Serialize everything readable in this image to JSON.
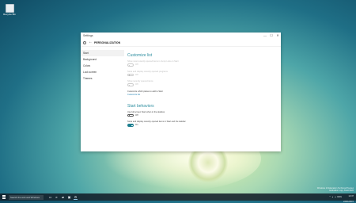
{
  "desktop": {
    "icon_label": "Recycle Bin",
    "watermark": {
      "line1": "Windows 10 Education Technical Preview",
      "line2": "Evaluation copy. Build 9926"
    }
  },
  "window": {
    "title": "Settings",
    "minimize": "—",
    "maximize": "☐",
    "close": "✕",
    "header_title": "PERSONALIZATION",
    "back_arrow": "←"
  },
  "nav": {
    "items": [
      {
        "label": "Start"
      },
      {
        "label": "Background"
      },
      {
        "label": "Colors"
      },
      {
        "label": "Lock screen"
      },
      {
        "label": "Themes"
      }
    ]
  },
  "content": {
    "section1_title": "Customize list",
    "s1_line1": "Show most recently opened items in Jump Lists on Start",
    "s1_toggle1": "Off",
    "s1_line2": "Store and display recently opened programs",
    "s1_toggle2": "Off",
    "s1_line3": "Show recently opened items",
    "s1_toggle3": "Off",
    "s1_line4": "Customize which places to add to Start",
    "s1_link": "Customize list",
    "section2_title": "Start behaviors",
    "s2_line1": "Use full screen Start when in the desktop",
    "s2_toggle1": "Off",
    "s2_line2": "Store and display recently opened items in Start and the taskbar",
    "s2_toggle2": "On"
  },
  "taskbar": {
    "search_placeholder": "Search the web and Windows",
    "icons": [
      "task-view-icon",
      "ie-icon",
      "folder-icon",
      "store-icon"
    ],
    "tray_lang": "ENG",
    "time": "12:47",
    "date": "22/01/2015"
  },
  "colors": {
    "accent": "#1e7f90",
    "section_title": "#2e8ea0",
    "link": "#1f7fb2"
  }
}
